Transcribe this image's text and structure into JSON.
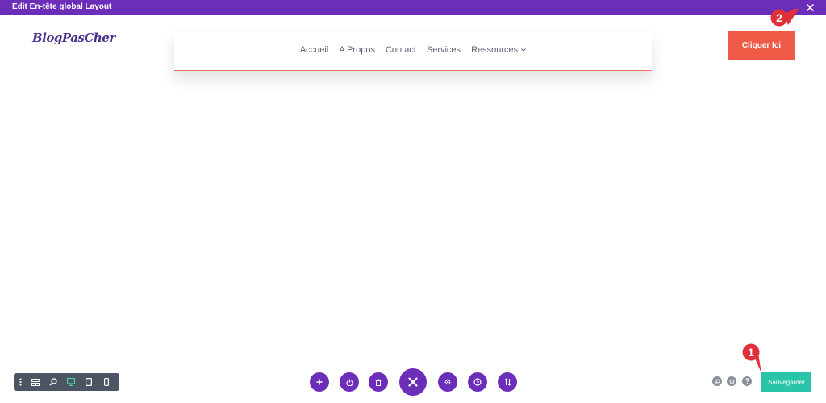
{
  "window": {
    "title": "Edit En-tête global Layout",
    "close_icon": "close-icon"
  },
  "header": {
    "logo_text": "BlogPasCher",
    "menu": [
      {
        "label": "Accueil"
      },
      {
        "label": "A Propos"
      },
      {
        "label": "Contact"
      },
      {
        "label": "Services"
      },
      {
        "label": "Ressources",
        "has_dropdown": true
      }
    ],
    "cta_label": "Cliquer Ici"
  },
  "annotations": [
    {
      "label": "2",
      "points_to": "close-button"
    },
    {
      "label": "1",
      "points_to": "save-button"
    }
  ],
  "bottom_left_toolbar": {
    "icons": [
      "more-vertical-icon",
      "wireframe-icon",
      "zoom-icon",
      "desktop-icon",
      "tablet-icon",
      "phone-icon"
    ],
    "active": "desktop-icon"
  },
  "bottom_center_toolbar": {
    "icons": [
      "add-icon",
      "power-icon",
      "trash-icon",
      "close-icon",
      "settings-icon",
      "history-icon",
      "portability-icon"
    ]
  },
  "bottom_right": {
    "icons": [
      "search-icon",
      "help-layer-icon",
      "help-icon"
    ],
    "save_label": "Sauvegarder"
  },
  "colors": {
    "top_bar": "#6c2eb9",
    "accent_purple": "#6c2eb9",
    "cta": "#f05a47",
    "save": "#29c4a9",
    "marker": "#e0313b",
    "menu_text": "#6a5a77"
  }
}
